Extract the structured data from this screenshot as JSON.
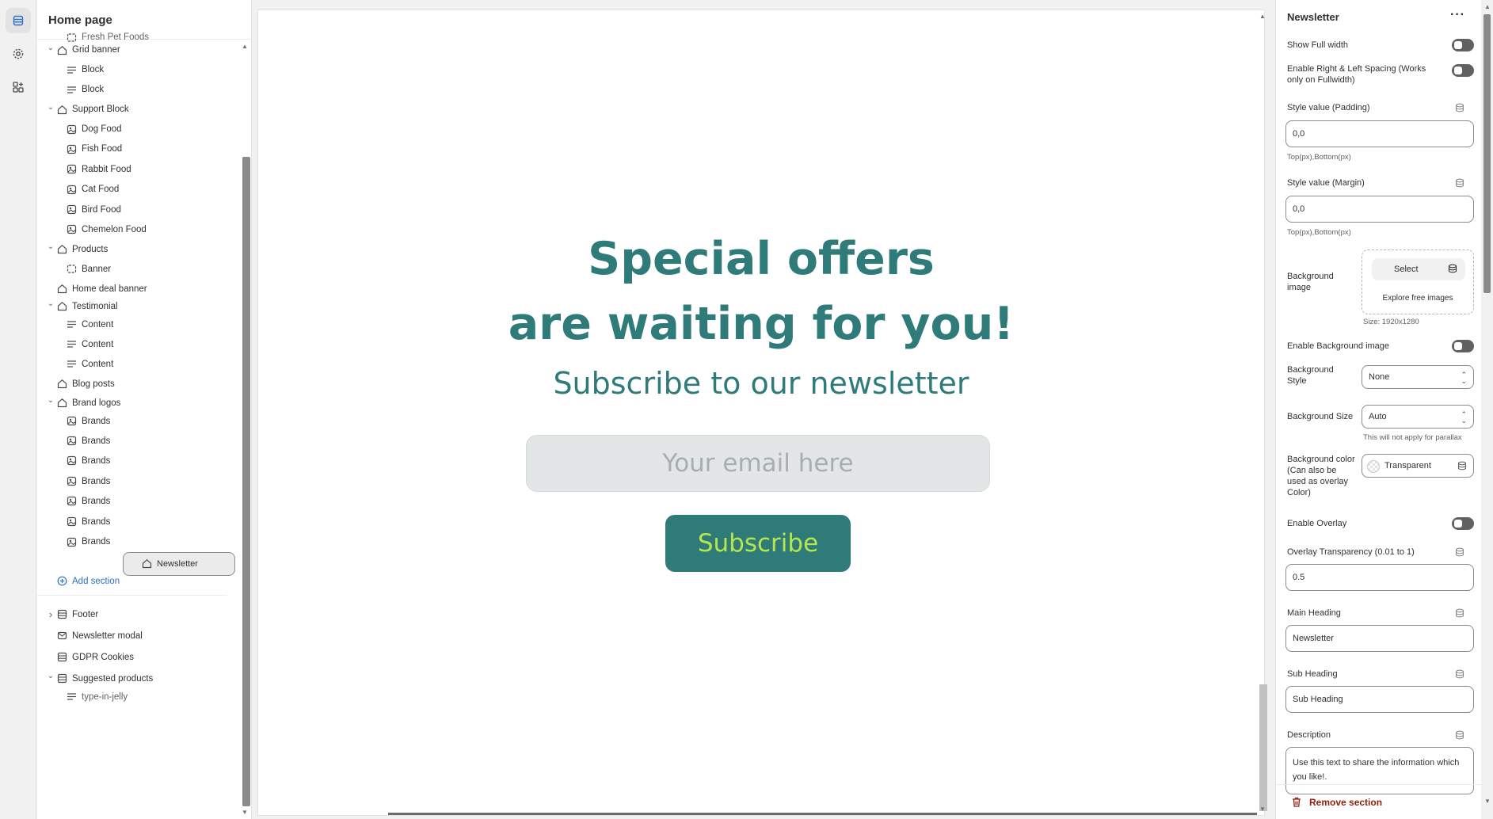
{
  "sidebar": {
    "title": "Home page",
    "cut_top_label": "Fresh Pet Foods",
    "items": [
      {
        "label": "Grid banner",
        "level": 0,
        "chevron": "down",
        "icon": "section-icon"
      },
      {
        "label": "Block",
        "level": 1,
        "icon": "text-block-icon"
      },
      {
        "label": "Block",
        "level": 1,
        "icon": "text-block-icon"
      },
      {
        "label": "Support Block",
        "level": 0,
        "chevron": "down",
        "icon": "section-icon"
      },
      {
        "label": "Dog Food",
        "level": 1,
        "icon": "image-block-icon"
      },
      {
        "label": "Fish Food",
        "level": 1,
        "icon": "image-block-icon"
      },
      {
        "label": "Rabbit Food",
        "level": 1,
        "icon": "image-block-icon"
      },
      {
        "label": "Cat Food",
        "level": 1,
        "icon": "image-block-icon"
      },
      {
        "label": "Bird Food",
        "level": 1,
        "icon": "image-block-icon"
      },
      {
        "label": "Chemelon Food",
        "level": 1,
        "icon": "image-block-icon"
      },
      {
        "label": "Products",
        "level": 0,
        "chevron": "down",
        "icon": "section-icon"
      },
      {
        "label": "Banner",
        "level": 1,
        "icon": "banner-block-icon"
      },
      {
        "label": "Home deal banner",
        "level": 0,
        "icon": "section-icon"
      },
      {
        "label": "Testimonial",
        "level": 0,
        "chevron": "down",
        "icon": "section-icon"
      },
      {
        "label": "Content",
        "level": 1,
        "icon": "text-block-icon"
      },
      {
        "label": "Content",
        "level": 1,
        "icon": "text-block-icon"
      },
      {
        "label": "Content",
        "level": 1,
        "icon": "text-block-icon"
      },
      {
        "label": "Blog posts",
        "level": 0,
        "icon": "section-icon"
      },
      {
        "label": "Brand logos",
        "level": 0,
        "chevron": "down",
        "icon": "section-icon"
      },
      {
        "label": "Brands",
        "level": 1,
        "icon": "image-block-icon"
      },
      {
        "label": "Brands",
        "level": 1,
        "icon": "image-block-icon"
      },
      {
        "label": "Brands",
        "level": 1,
        "icon": "image-block-icon"
      },
      {
        "label": "Brands",
        "level": 1,
        "icon": "image-block-icon"
      },
      {
        "label": "Brands",
        "level": 1,
        "icon": "image-block-icon"
      },
      {
        "label": "Brands",
        "level": 1,
        "icon": "image-block-icon"
      },
      {
        "label": "Brands",
        "level": 1,
        "icon": "image-block-icon"
      },
      {
        "label": "Newsletter",
        "level": 0,
        "icon": "section-icon",
        "selected": true
      }
    ],
    "add_section": "Add section",
    "footer_items": [
      {
        "label": "Footer",
        "chevron": "right",
        "icon": "footer-icon"
      },
      {
        "label": "Newsletter modal",
        "icon": "modal-icon"
      },
      {
        "label": "GDPR Cookies",
        "icon": "footer-icon"
      },
      {
        "label": "Suggested products",
        "chevron": "down",
        "icon": "footer-icon"
      }
    ],
    "cut_bottom_label": "type-in-jelly"
  },
  "preview": {
    "heading_line1": "Special offers",
    "heading_line2": "are waiting for you!",
    "subheading": "Subscribe to our newsletter",
    "email_placeholder": "Your email here",
    "button_label": "Subscribe",
    "colors": {
      "teal": "#2f7b7a",
      "lime": "#b7e64c",
      "input_bg": "#e3e6e6"
    }
  },
  "panel": {
    "title": "Newsletter",
    "more_icon": "more-horizontal-icon",
    "show_full_width": "Show Full width",
    "enable_spacing": "Enable Right & Left Spacing (Works only on Fullwidth)",
    "padding_label": "Style value (Padding)",
    "padding_value": "0,0",
    "padding_hint": "Top(px),Bottom(px)",
    "margin_label": "Style value (Margin)",
    "margin_value": "0,0",
    "margin_hint": "Top(px),Bottom(px)",
    "bg_image_label": "Background image",
    "select_label": "Select",
    "explore_label": "Explore free images",
    "size_hint": "Size: 1920x1280",
    "enable_bg_image": "Enable Background image",
    "bg_style_label": "Background Style",
    "bg_style_value": "None",
    "bg_size_label": "Background Size",
    "bg_size_value": "Auto",
    "parallax_hint": "This will not apply for parallax",
    "bg_color_label": "Background color (Can also be used as overlay Color)",
    "bg_color_value": "Transparent",
    "enable_overlay": "Enable Overlay",
    "overlay_label": "Overlay Transparency (0.01 to 1)",
    "overlay_value": "0.5",
    "main_heading_label": "Main Heading",
    "main_heading_value": "Newsletter",
    "sub_heading_label": "Sub Heading",
    "sub_heading_value": "Sub Heading",
    "description_label": "Description",
    "description_value": "Use this text to share the information which you like!.",
    "remove_label": "Remove section"
  }
}
